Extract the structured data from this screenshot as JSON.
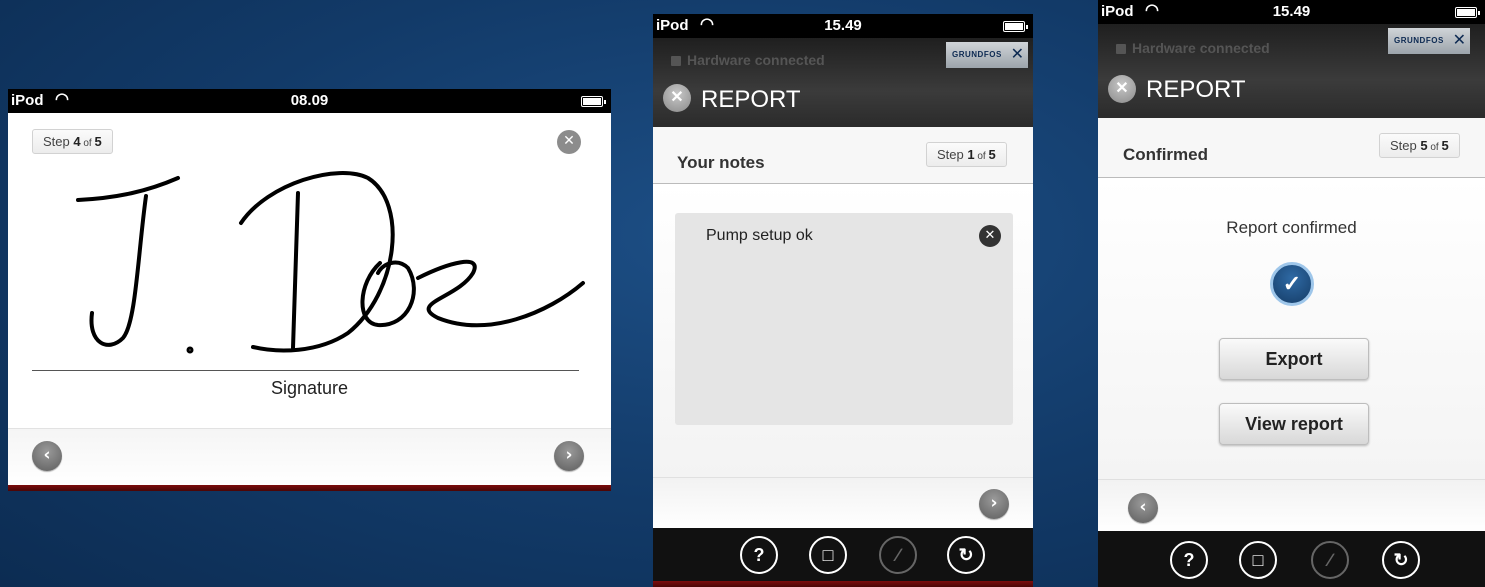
{
  "left": {
    "status": {
      "carrier": "iPod",
      "time": "08.09"
    },
    "step": {
      "prefix": "Step ",
      "current": "4",
      "of": " of ",
      "total": "5"
    },
    "signature_label": "Signature",
    "signature_text": "J. Doe"
  },
  "middle": {
    "status": {
      "carrier": "iPod",
      "time": "15.49"
    },
    "hardware": "Hardware connected",
    "brand": "GRUNDFOS",
    "title": "REPORT",
    "section": "Your notes",
    "step": {
      "prefix": "Step ",
      "current": "1",
      "of": " of ",
      "total": "5"
    },
    "note_text": "Pump setup ok"
  },
  "right": {
    "status": {
      "carrier": "iPod",
      "time": "15.49"
    },
    "hardware": "Hardware connected",
    "brand": "GRUNDFOS",
    "title": "REPORT",
    "section": "Confirmed",
    "step": {
      "prefix": "Step ",
      "current": "5",
      "of": " of ",
      "total": "5"
    },
    "confirmed_text": "Report confirmed",
    "export_label": "Export",
    "view_label": "View report"
  },
  "toolbar_icons": [
    "help-icon",
    "copy-icon",
    "edit-icon",
    "refresh-icon"
  ],
  "colors": {
    "background": "#123a68",
    "accent_red": "#7c0d0d",
    "check_blue": "#1e4f82"
  }
}
